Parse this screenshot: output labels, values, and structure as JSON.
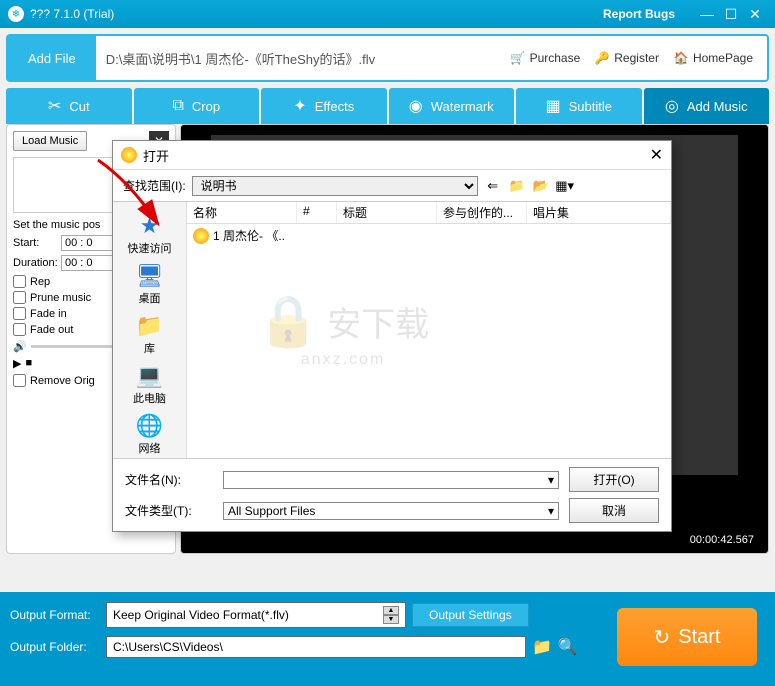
{
  "title": "??? 7.1.0 (Trial)",
  "report_bugs": "Report Bugs",
  "toolbar": {
    "add_file": "Add File",
    "filepath": "D:\\桌面\\说明书\\1 周杰伦-《听TheShy的话》.flv",
    "purchase": "Purchase",
    "register": "Register",
    "homepage": "HomePage"
  },
  "tabs": {
    "cut": "Cut",
    "crop": "Crop",
    "effects": "Effects",
    "watermark": "Watermark",
    "subtitle": "Subtitle",
    "add_music": "Add Music"
  },
  "left": {
    "load_music": "Load Music",
    "set_pos": "Set the music pos",
    "start": "Start:",
    "start_val": "00 : 0",
    "duration": "Duration:",
    "duration_val": "00 : 0",
    "repeat": "Rep",
    "prune": "Prune music",
    "fade_in": "Fade in",
    "fade_out": "Fade out",
    "remove_orig": "Remove Orig"
  },
  "preview": {
    "timestamp": "00:00:42.567"
  },
  "bottom": {
    "output_format": "Output Format:",
    "format_value": "Keep Original Video Format(*.flv)",
    "output_settings": "Output Settings",
    "output_folder": "Output Folder:",
    "folder_value": "C:\\Users\\CS\\Videos\\",
    "start": "Start"
  },
  "dialog": {
    "title": "打开",
    "look_in": "查找范围(I):",
    "folder": "说明书",
    "cols": {
      "name": "名称",
      "num": "#",
      "title": "标题",
      "artist": "参与创作的...",
      "album": "唱片集"
    },
    "file_item": "1 周杰伦- 《..",
    "sidebar": {
      "quick": "快速访问",
      "desktop": "桌面",
      "lib": "库",
      "pc": "此电脑",
      "net": "网络"
    },
    "file_name": "文件名(N):",
    "file_type": "文件类型(T):",
    "type_value": "All Support Files",
    "open_btn": "打开(O)",
    "cancel_btn": "取消"
  },
  "watermark": {
    "line1": "安下载",
    "line2": "anxz.com"
  }
}
